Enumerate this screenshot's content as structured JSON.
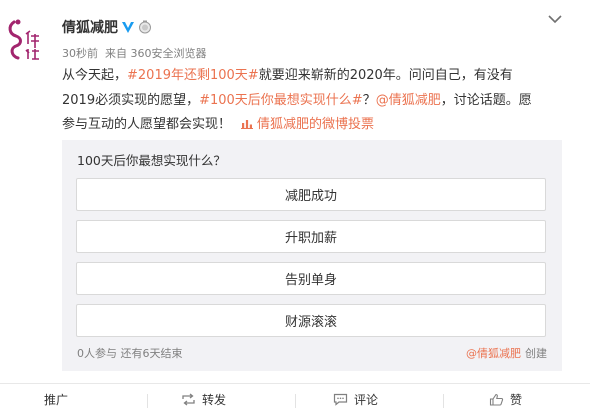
{
  "post": {
    "author": "倩狐减肥",
    "meta": {
      "time": "30秒前",
      "from_prefix": "来自",
      "source": "360安全浏览器"
    },
    "body": {
      "t1": "从今天起，",
      "tag1": "#2019年还剩100天#",
      "t2": "就要迎来崭新的2020年。问问自己，有没有2019必须实现的愿望，",
      "tag2": "#100天后你最想实现什么#",
      "t3": "？",
      "mention": "@倩狐减肥",
      "t4": "，讨论话题。愿参与互动的人愿望都会实现！",
      "vote_link": "倩狐减肥的微博投票"
    }
  },
  "poll": {
    "question": "100天后你最想实现什么？",
    "options": [
      "减肥成功",
      "升职加薪",
      "告别单身",
      "财源滚滚"
    ],
    "participants": "0人参与",
    "remaining": "还有6天结束",
    "creator": "@倩狐减肥",
    "created_label": "创建"
  },
  "actions": {
    "promote": "推广",
    "repost": "转发",
    "comment": "评论",
    "like": "赞"
  },
  "colors": {
    "accent": "#eb7350",
    "verified": "#1a9cf0",
    "poll_bg": "#f2f2f5",
    "meta_gray": "#808080"
  },
  "icons": [
    "avatar-logo",
    "verified-v-icon",
    "medal-icon",
    "chevron-down-icon",
    "vote-chart-icon",
    "repost-icon",
    "comment-icon",
    "like-icon"
  ]
}
